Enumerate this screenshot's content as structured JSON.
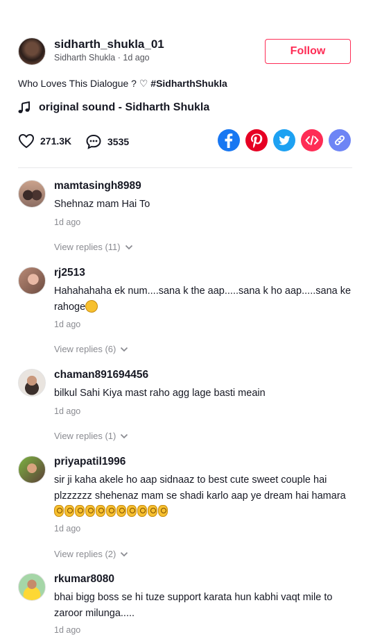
{
  "post": {
    "username": "sidharth_shukla_01",
    "display_name": "Sidharth Shukla",
    "time": "1d ago",
    "subline_sep": " · ",
    "follow_label": "Follow",
    "caption_text": "Who Loves This Dialogue ? ♡ ",
    "caption_hashtag": "#SidharthShukla",
    "sound": "original sound - Sidharth Shukla",
    "likes": "271.3K",
    "comments_count": "3535"
  },
  "share_buttons": [
    {
      "icon": "facebook-icon",
      "color": "#1877f2"
    },
    {
      "icon": "pinterest-icon",
      "color": "#e60023"
    },
    {
      "icon": "twitter-icon",
      "color": "#1da1f2"
    },
    {
      "icon": "embed-icon",
      "color": "#fe2c55"
    },
    {
      "icon": "link-icon",
      "color": "#6e85f5"
    }
  ],
  "comments": [
    {
      "user": "mamtasingh8989",
      "text": "Shehnaz mam Hai To",
      "time": "1d ago",
      "replies": "View replies (11)"
    },
    {
      "user": "rj2513",
      "text": "Hahahahaha ek num....sana k the aap.....sana k ho aap.....sana ke rahoge",
      "time": "1d ago",
      "replies": "View replies (6)"
    },
    {
      "user": "chaman891694456",
      "text": "bilkul Sahi Kiya mast raho agg lage basti meain",
      "time": "1d ago",
      "replies": "View replies (1)"
    },
    {
      "user": "priyapatil1996",
      "text": "sir ji kaha akele ho aap sidnaaz to best cute sweet couple hai plzzzzzz shehenaz mam se shadi karlo aap ye dream hai hamara",
      "time": "1d ago",
      "replies": "View replies (2)"
    },
    {
      "user": "rkumar8080",
      "text": "bhai bigg boss se hi tuze support karata hun kabhi vaqt mile to zaroor milunga.....",
      "time": "1d ago"
    }
  ]
}
